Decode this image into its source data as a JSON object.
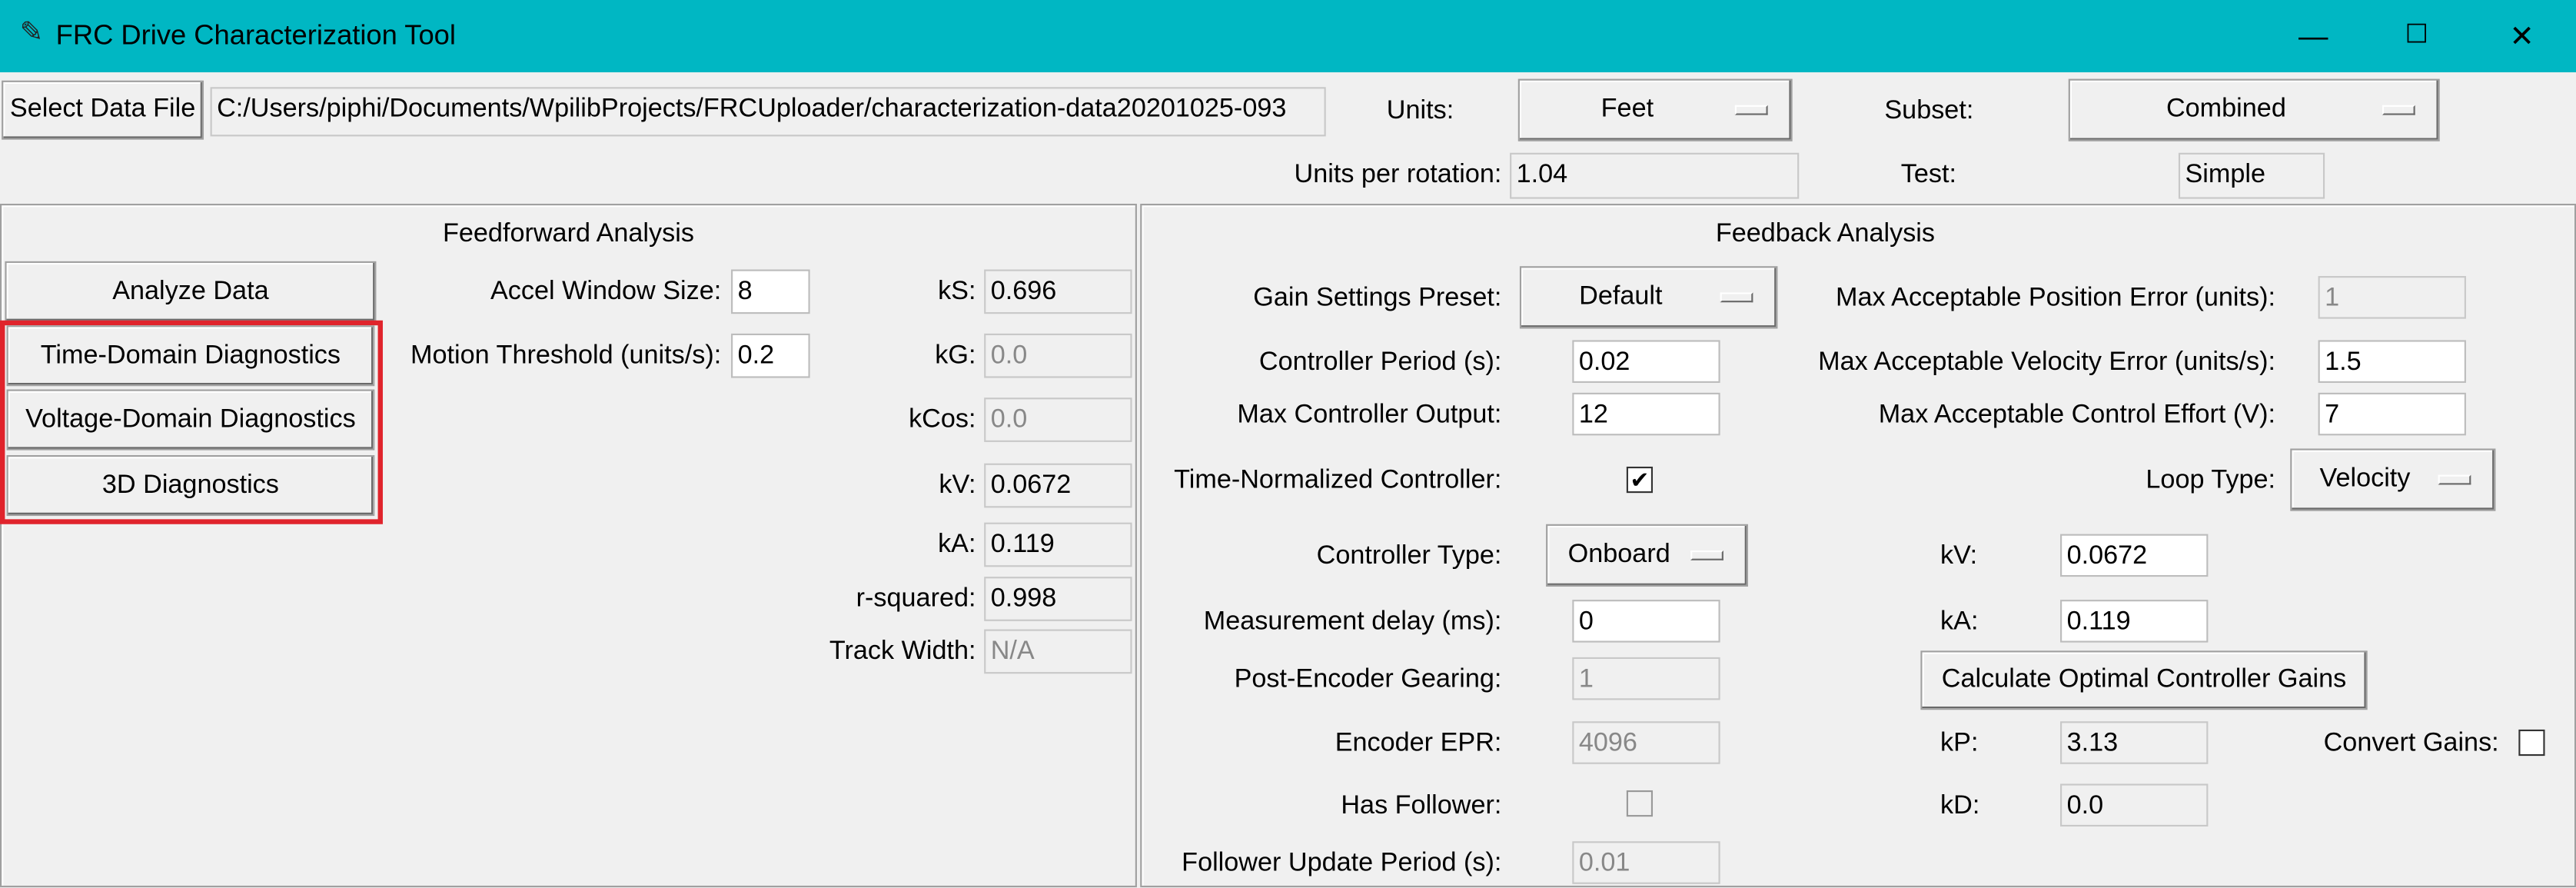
{
  "window": {
    "title": "FRC Drive Characterization Tool",
    "minimize": "—",
    "maximize": "☐",
    "close": "✕"
  },
  "top": {
    "select_file_label": "Select Data File",
    "file_path": "C:/Users/piphi/Documents/WpilibProjects/FRCUploader/characterization-data20201025-093",
    "units_label": "Units:",
    "units_value": "Feet",
    "subset_label": "Subset:",
    "subset_value": "Combined",
    "units_per_rotation_label": "Units per rotation:",
    "units_per_rotation_value": "1.04",
    "test_label": "Test:",
    "test_value": "Simple"
  },
  "feedforward": {
    "title": "Feedforward Analysis",
    "analyze_button": "Analyze Data",
    "time_domain_button": "Time-Domain Diagnostics",
    "voltage_domain_button": "Voltage-Domain Diagnostics",
    "diag_3d_button": "3D Diagnostics",
    "accel_window_label": "Accel Window Size:",
    "accel_window_value": "8",
    "motion_threshold_label": "Motion Threshold (units/s):",
    "motion_threshold_value": "0.2",
    "ks_label": "kS:",
    "ks_value": "0.696",
    "kg_label": "kG:",
    "kg_value": "0.0",
    "kcos_label": "kCos:",
    "kcos_value": "0.0",
    "kv_label": "kV:",
    "kv_value": "0.0672",
    "ka_label": "kA:",
    "ka_value": "0.119",
    "rsq_label": "r-squared:",
    "rsq_value": "0.998",
    "track_label": "Track Width:",
    "track_value": "N/A"
  },
  "feedback": {
    "title": "Feedback Analysis",
    "gain_preset_label": "Gain Settings Preset:",
    "gain_preset_value": "Default",
    "max_pos_err_label": "Max Acceptable Position Error (units):",
    "max_pos_err_value": "1",
    "controller_period_label": "Controller Period (s):",
    "controller_period_value": "0.02",
    "max_vel_err_label": "Max Acceptable Velocity Error (units/s):",
    "max_vel_err_value": "1.5",
    "max_ctrl_out_label": "Max Controller Output:",
    "max_ctrl_out_value": "12",
    "max_effort_label": "Max Acceptable Control Effort (V):",
    "max_effort_value": "7",
    "time_norm_label": "Time-Normalized Controller:",
    "time_norm_check": "✔",
    "loop_type_label": "Loop Type:",
    "loop_type_value": "Velocity",
    "controller_type_label": "Controller Type:",
    "controller_type_value": "Onboard",
    "kv_label": "kV:",
    "kv_value": "0.0672",
    "meas_delay_label": "Measurement delay (ms):",
    "meas_delay_value": "0",
    "ka_label": "kA:",
    "ka_value": "0.119",
    "post_enc_label": "Post-Encoder Gearing:",
    "post_enc_value": "1",
    "calc_button": "Calculate Optimal Controller Gains",
    "encoder_epr_label": "Encoder EPR:",
    "encoder_epr_value": "4096",
    "kp_label": "kP:",
    "kp_value": "3.13",
    "convert_label": "Convert Gains:",
    "has_follower_label": "Has Follower:",
    "kd_label": "kD:",
    "kd_value": "0.0",
    "follower_period_label": "Follower Update Period (s):",
    "follower_period_value": "0.01"
  },
  "colors": {
    "titlebar": "#00b7c3",
    "highlight": "#e0242c"
  }
}
